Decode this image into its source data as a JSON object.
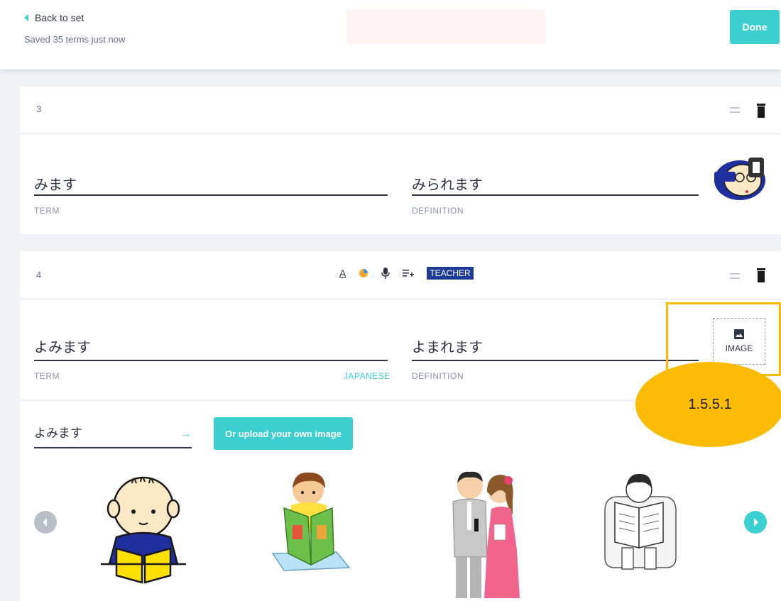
{
  "header": {
    "back_label": "Back to set",
    "saved_status": "Saved 35 terms just now",
    "done_label": "Done"
  },
  "cards": [
    {
      "number": "3",
      "term": "みます",
      "definition": "みられます",
      "term_label": "TERM",
      "definition_label": "DEFINITION",
      "image": "cartoon-face-with-glasses"
    },
    {
      "number": "4",
      "term": "よみます",
      "definition": "よまれます",
      "term_label": "TERM",
      "definition_label": "DEFINITION",
      "term_language": "JAPANESE",
      "image_slot_label": "IMAGE",
      "toolbar": {
        "text_format": "A",
        "teacher_label": "TEACHER"
      }
    }
  ],
  "image_search": {
    "query": "よみます",
    "upload_label": "Or upload your own image",
    "results": [
      "child-reading-book",
      "boy-reading-picture-book",
      "couple-wedding-reading",
      "man-reading-newspaper"
    ]
  },
  "annotation": {
    "step_label": "1.5.5.1",
    "highlight_color": "#fcb900"
  },
  "colors": {
    "accent": "#3ccfcf",
    "teacher_badge": "#1f3b94"
  }
}
